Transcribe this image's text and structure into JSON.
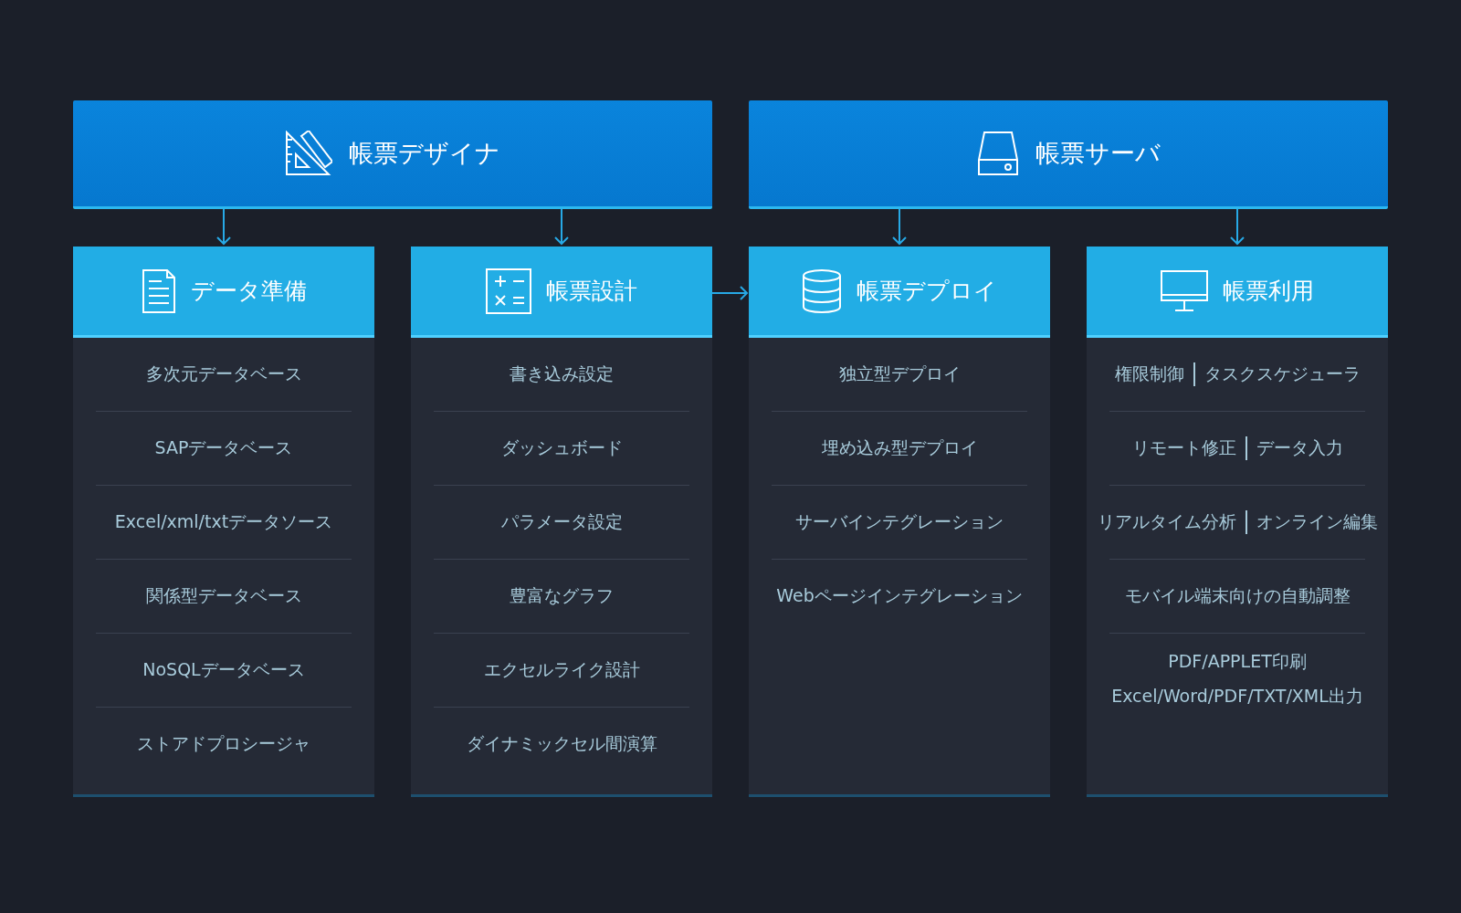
{
  "top_boxes": [
    {
      "title": "帳票デザイナ"
    },
    {
      "title": "帳票サーバ"
    }
  ],
  "columns": [
    {
      "title": "データ準備",
      "items": [
        {
          "kind": "single",
          "texts": [
            "多次元データベース"
          ]
        },
        {
          "kind": "single",
          "texts": [
            "SAPデータベース"
          ]
        },
        {
          "kind": "single",
          "texts": [
            "Excel/xml/txtデータソース"
          ]
        },
        {
          "kind": "single",
          "texts": [
            "関係型データベース"
          ]
        },
        {
          "kind": "single",
          "texts": [
            "NoSQLデータベース"
          ]
        },
        {
          "kind": "single",
          "texts": [
            "ストアドプロシージャ"
          ]
        }
      ]
    },
    {
      "title": "帳票設計",
      "items": [
        {
          "kind": "single",
          "texts": [
            "書き込み設定"
          ]
        },
        {
          "kind": "single",
          "texts": [
            "ダッシュボード"
          ]
        },
        {
          "kind": "single",
          "texts": [
            "パラメータ設定"
          ]
        },
        {
          "kind": "single",
          "texts": [
            "豊富なグラフ"
          ]
        },
        {
          "kind": "single",
          "texts": [
            "エクセルライク設計"
          ]
        },
        {
          "kind": "single",
          "texts": [
            "ダイナミックセル間演算"
          ]
        }
      ]
    },
    {
      "title": "帳票デプロイ",
      "items": [
        {
          "kind": "single",
          "texts": [
            "独立型デプロイ"
          ]
        },
        {
          "kind": "single",
          "texts": [
            "埋め込み型デプロイ"
          ]
        },
        {
          "kind": "single",
          "texts": [
            "サーバインテグレーション"
          ]
        },
        {
          "kind": "single",
          "texts": [
            "Webページインテグレーション"
          ]
        }
      ]
    },
    {
      "title": "帳票利用",
      "items": [
        {
          "kind": "pair",
          "texts": [
            "権限制御",
            "タスクスケジューラ"
          ]
        },
        {
          "kind": "pair",
          "texts": [
            "リモート修正",
            "データ入力"
          ]
        },
        {
          "kind": "pair",
          "texts": [
            "リアルタイム分析",
            "オンライン編集"
          ]
        },
        {
          "kind": "single",
          "texts": [
            "モバイル端末向けの自動調整"
          ]
        },
        {
          "kind": "stack",
          "texts": [
            "PDF/APPLET印刷",
            "Excel/Word/PDF/TXT/XML出力"
          ]
        }
      ]
    }
  ]
}
